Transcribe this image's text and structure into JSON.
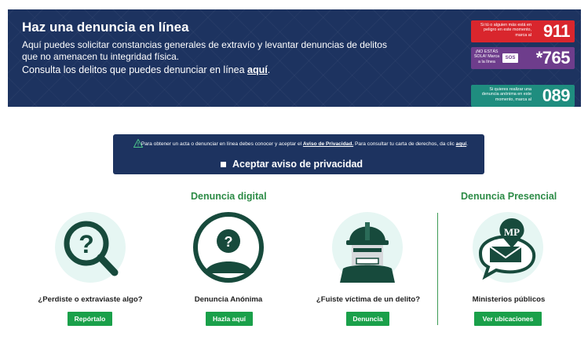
{
  "hero": {
    "title": "Haz una denuncia en línea",
    "description": "Aquí puedes solicitar constancias generales de extravío y levantar denuncias de delitos que no amenacen tu integridad física.",
    "consult_prefix": "Consulta los delitos que puedes denunciar en línea ",
    "consult_link": "aquí",
    "consult_suffix": "."
  },
  "emergency": [
    {
      "text": "Si tú o alguien más está en peligro en este momento, marca al",
      "number": "911",
      "color": "#d9262d"
    },
    {
      "text": "¡NO ESTÁS SOLA! Marca a la línea",
      "badge": "SOS",
      "number": "*765",
      "color": "#6e3d8c"
    },
    {
      "text": "Si quieres realizar una denuncia anónima en este momento, marca al",
      "number": "089",
      "color": "#1f8d7f"
    }
  ],
  "privacy": {
    "text_prefix": "Para obtener un acta o denunciar en línea debes conocer y aceptar el ",
    "link": "Aviso de Privacidad.",
    "text_middle": "  Para consultar tu carta de derechos, da clic ",
    "link2": "aquí",
    "text_suffix": ".",
    "checkbox_label": "Aceptar aviso de privacidad",
    "checked": false
  },
  "sections": {
    "digital": "Denuncia digital",
    "presencial": "Denuncia Presencial"
  },
  "cards": [
    {
      "label": "¿Perdiste o extraviaste algo?",
      "button": "Repórtalo",
      "icon": "magnifier-question-icon"
    },
    {
      "label": "Denuncia Anónima",
      "button": "Hazla aquí",
      "icon": "anonymous-person-icon"
    },
    {
      "label": "¿Fuiste víctima de un delito?",
      "button": "Denuncia",
      "icon": "masked-thief-icon"
    },
    {
      "label": "Ministerios públicos",
      "button": "Ver ubicaciones",
      "icon": "mp-location-icon",
      "badge": "MP"
    }
  ],
  "colors": {
    "navy": "#1d3360",
    "green": "#1aa04a",
    "section_green": "#2c8b46",
    "icon_dark": "#174a3c",
    "icon_bg": "#e6f6f3"
  }
}
